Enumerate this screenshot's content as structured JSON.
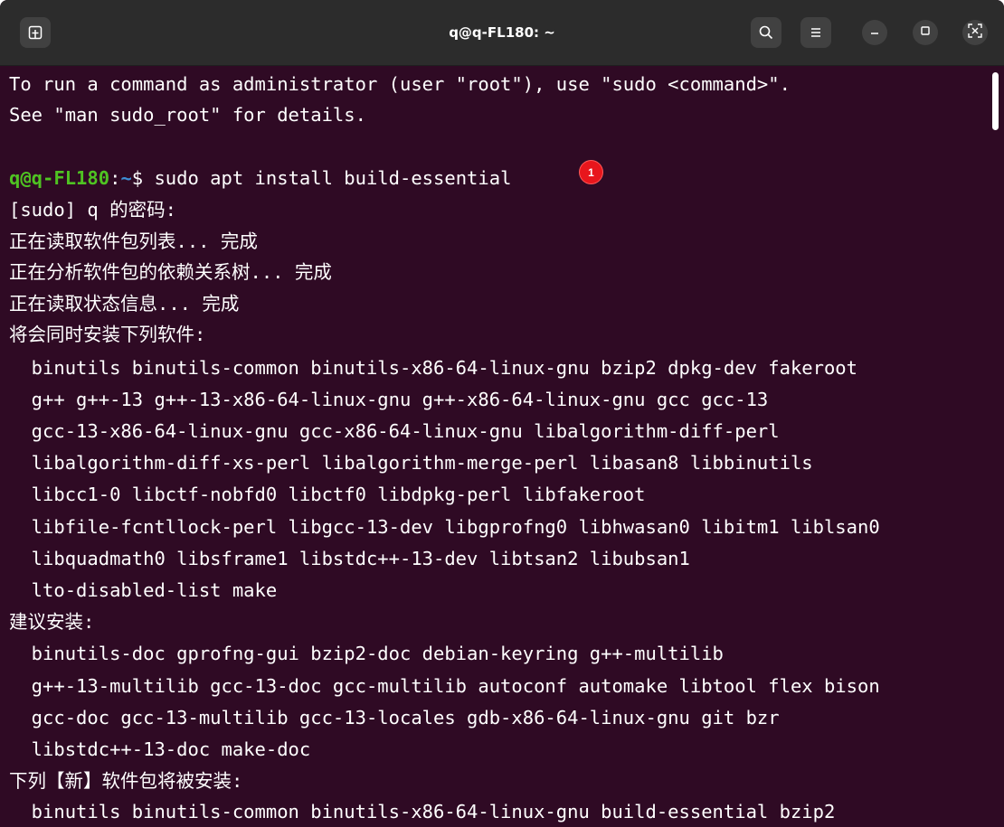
{
  "window": {
    "title": "q@q-FL180: ~",
    "background": "#2f0a24",
    "titlebar_background": "#2c2c2c"
  },
  "titlebar": {
    "new_tab_icon": "new-tab-icon",
    "search_icon": "search-icon",
    "menu_icon": "hamburger-menu-icon",
    "minimize_icon": "minimize-icon",
    "maximize_icon": "maximize-icon",
    "close_icon": "close-icon"
  },
  "colors": {
    "prompt_user": "#4fc322",
    "prompt_path": "#3d8fd6",
    "text": "#ffffff",
    "badge": "#e8161c"
  },
  "terminal": {
    "prompt": {
      "user_host": "q@q-FL180",
      "separator": ":",
      "path": "~",
      "symbol": "$ ",
      "command": "sudo apt install build-essential"
    },
    "badge": "1",
    "lines": [
      "To run a command as administrator (user \"root\"), use \"sudo <command>\".",
      "See \"man sudo_root\" for details.",
      "",
      "",
      "[sudo] q 的密码:",
      "正在读取软件包列表... 完成",
      "正在分析软件包的依赖关系树... 完成",
      "正在读取状态信息... 完成",
      "将会同时安装下列软件:",
      "  binutils binutils-common binutils-x86-64-linux-gnu bzip2 dpkg-dev fakeroot",
      "  g++ g++-13 g++-13-x86-64-linux-gnu g++-x86-64-linux-gnu gcc gcc-13",
      "  gcc-13-x86-64-linux-gnu gcc-x86-64-linux-gnu libalgorithm-diff-perl",
      "  libalgorithm-diff-xs-perl libalgorithm-merge-perl libasan8 libbinutils",
      "  libcc1-0 libctf-nobfd0 libctf0 libdpkg-perl libfakeroot",
      "  libfile-fcntllock-perl libgcc-13-dev libgprofng0 libhwasan0 libitm1 liblsan0",
      "  libquadmath0 libsframe1 libstdc++-13-dev libtsan2 libubsan1",
      "  lto-disabled-list make",
      "建议安装:",
      "  binutils-doc gprofng-gui bzip2-doc debian-keyring g++-multilib",
      "  g++-13-multilib gcc-13-doc gcc-multilib autoconf automake libtool flex bison",
      "  gcc-doc gcc-13-multilib gcc-13-locales gdb-x86-64-linux-gnu git bzr",
      "  libstdc++-13-doc make-doc",
      "下列【新】软件包将被安装:",
      "  binutils binutils-common binutils-x86-64-linux-gnu build-essential bzip2"
    ]
  }
}
